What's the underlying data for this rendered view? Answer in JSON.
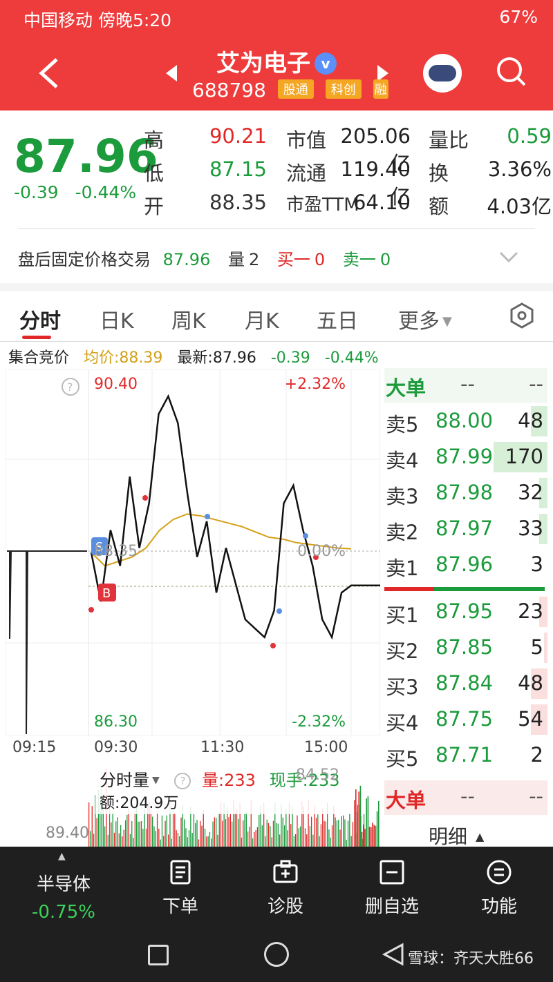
{
  "status_bar": {
    "carrier_time": "中国移动 傍晚5:20",
    "battery": "67%"
  },
  "header": {
    "stock_name": "艾为电子",
    "verified_mark": "v",
    "code": "688798",
    "tag_fragment_1": "股通",
    "tag_star": "科创",
    "tag_fragment_2": "融"
  },
  "quote": {
    "price": "87.96",
    "change": "-0.39",
    "change_pct": "-0.44%",
    "rows": [
      {
        "l1": "高",
        "v1": "90.21",
        "l2": "市值",
        "v2": "205.06亿",
        "l3": "量比",
        "v3": "0.59"
      },
      {
        "l1": "低",
        "v1": "87.15",
        "l2": "流通",
        "v2": "119.40亿",
        "l3": "换",
        "v3": "3.36%"
      },
      {
        "l1": "开",
        "v1": "88.35",
        "l2": "市盈TTM",
        "v2": "64.10",
        "l3": "额",
        "v3": "4.03亿"
      }
    ]
  },
  "after_hours": {
    "label": "盘后固定价格交易",
    "price": "87.96",
    "vol_label": "量",
    "vol": "2",
    "buy1_label": "买一",
    "buy1": "0",
    "sell1_label": "卖一",
    "sell1": "0"
  },
  "tabs": [
    "分时",
    "日K",
    "周K",
    "月K",
    "五日",
    "更多"
  ],
  "info_bar": {
    "auction": "集合竞价",
    "avg": "均价:88.39",
    "latest": "最新:87.96",
    "chg": "-0.39",
    "chg_pct": "-0.44%"
  },
  "chart_data": {
    "type": "line",
    "title": "",
    "y_high_label": "90.40",
    "y_low_label": "86.30",
    "pct_high_label": "+2.32%",
    "pct_low_label": "-2.32%",
    "prev_close_label": "88.35",
    "zero_pct_label": "0.00%",
    "ylim": [
      86.3,
      90.4
    ],
    "time_labels": [
      "09:15",
      "09:30",
      "11:30",
      "15:00"
    ],
    "marker_b": "B",
    "marker_s": "S",
    "series": [
      {
        "values_price": [
          88.35,
          87.8,
          88.6,
          88.2,
          89.2,
          88.4,
          88.9,
          89.9,
          90.1,
          89.8,
          89.0,
          88.3,
          88.7,
          87.9,
          88.4,
          88.0,
          87.6,
          87.5,
          87.4,
          87.7,
          88.9,
          89.1,
          88.6,
          88.2,
          87.6,
          87.4,
          87.9,
          87.98
        ]
      },
      {
        "values_avg": [
          88.35,
          88.2,
          88.25,
          88.3,
          88.4,
          88.6,
          88.72,
          88.78,
          88.76,
          88.72,
          88.68,
          88.64,
          88.58,
          88.52,
          88.5,
          88.46,
          88.44,
          88.42,
          88.4,
          88.39
        ]
      }
    ]
  },
  "order_book": {
    "header_label": "大单",
    "header_dash1": "--",
    "header_dash2": "--",
    "asks": [
      {
        "label": "卖5",
        "price": "88.00",
        "vol": "48",
        "bar": 0.1
      },
      {
        "label": "卖4",
        "price": "87.99",
        "vol": "170",
        "bar": 0.33
      },
      {
        "label": "卖3",
        "price": "87.98",
        "vol": "32",
        "bar": 0.05
      },
      {
        "label": "卖2",
        "price": "87.97",
        "vol": "33",
        "bar": 0.05
      },
      {
        "label": "卖1",
        "price": "87.96",
        "vol": "3",
        "bar": 0.0
      }
    ],
    "bids": [
      {
        "label": "买1",
        "price": "87.95",
        "vol": "23",
        "bar": 0.05
      },
      {
        "label": "买2",
        "price": "87.85",
        "vol": "5",
        "bar": 0.02
      },
      {
        "label": "买3",
        "price": "87.84",
        "vol": "48",
        "bar": 0.1
      },
      {
        "label": "买4",
        "price": "87.75",
        "vol": "54",
        "bar": 0.1
      },
      {
        "label": "买5",
        "price": "87.71",
        "vol": "2",
        "bar": 0.0
      }
    ],
    "footer_label": "大单",
    "footer_dash1": "--",
    "footer_dash2": "--",
    "detail_label": "明细"
  },
  "volume_panel": {
    "selector": "分时量",
    "vol": "量:233",
    "cur": "现手:233",
    "overlap_val": "84.52",
    "amount": "额:204.9万",
    "left_val": "89.40"
  },
  "bottom_bar": {
    "sector_name": "半导体",
    "sector_chg": "-0.75%",
    "buttons": [
      "下单",
      "诊股",
      "删自选",
      "功能"
    ]
  },
  "watermark": "雪球：齐天大胜66",
  "colors": {
    "brand_red": "#ee3b3b",
    "up_red": "#e02828",
    "down_green": "#1c9b3c",
    "avg_line": "#d4a017"
  }
}
